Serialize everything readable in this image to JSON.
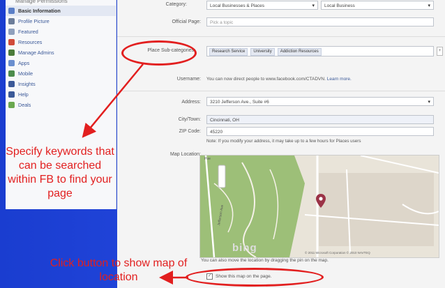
{
  "sidebar": {
    "top_item": "Manage Permissions",
    "items": [
      {
        "label": "Basic Information",
        "active": true,
        "icon": "info-icon",
        "color": "#5b7fc7"
      },
      {
        "label": "Profile Picture",
        "active": false,
        "icon": "picture-icon",
        "color": "#6c7d99"
      },
      {
        "label": "Featured",
        "active": false,
        "icon": "featured-icon",
        "color": "#8fa0bd"
      },
      {
        "label": "Resources",
        "active": false,
        "icon": "resources-icon",
        "color": "#d04b3a"
      },
      {
        "label": "Manage Admins",
        "active": false,
        "icon": "admins-icon",
        "color": "#4a7b3a"
      },
      {
        "label": "Apps",
        "active": false,
        "icon": "apps-icon",
        "color": "#6a8fcf"
      },
      {
        "label": "Mobile",
        "active": false,
        "icon": "mobile-icon",
        "color": "#4c8c4c"
      },
      {
        "label": "Insights",
        "active": false,
        "icon": "insights-icon",
        "color": "#3b5998"
      },
      {
        "label": "Help",
        "active": false,
        "icon": "help-icon",
        "color": "#3b5998"
      },
      {
        "label": "Deals",
        "active": false,
        "icon": "deals-icon",
        "color": "#6aa84f"
      }
    ]
  },
  "form": {
    "category_label": "Category:",
    "category_value": "Local Businesses & Places",
    "category_sub_value": "Local Business",
    "official_page_label": "Official Page:",
    "official_page_placeholder": "Pick a topic",
    "subcategories_label": "Place Sub-categories:",
    "subcategories": [
      "Research Service",
      "University",
      "Addiction Resources"
    ],
    "username_label": "Username:",
    "username_hint": "You can now direct people to www.facebook.com/CTADVN.",
    "username_link": "Learn more.",
    "address_label": "Address:",
    "address_value": "3210 Jefferson Ave., Suite #6",
    "city_label": "City/Town:",
    "city_value": "Cincinnati, OH",
    "zip_label": "ZIP Code:",
    "zip_value": "45220",
    "address_note": "Note: If you modify your address, it may take up to a few hours for Places users",
    "map_label": "Map Location:",
    "map_hint": "You can also move the location by dragging the pin on the map.",
    "map_checkbox_label": "Show this map on the page.",
    "map_copyright": "© 2011 Microsoft Corporation  © 2010 NAVTEQ",
    "map_brand": "bing",
    "map_street": "Jefferson Ave"
  },
  "annotations": {
    "keywords_text": "Specify keywords that can be searched within FB to find your page",
    "map_text": "Click button to show map of location",
    "accent_color": "#e21f1f"
  }
}
